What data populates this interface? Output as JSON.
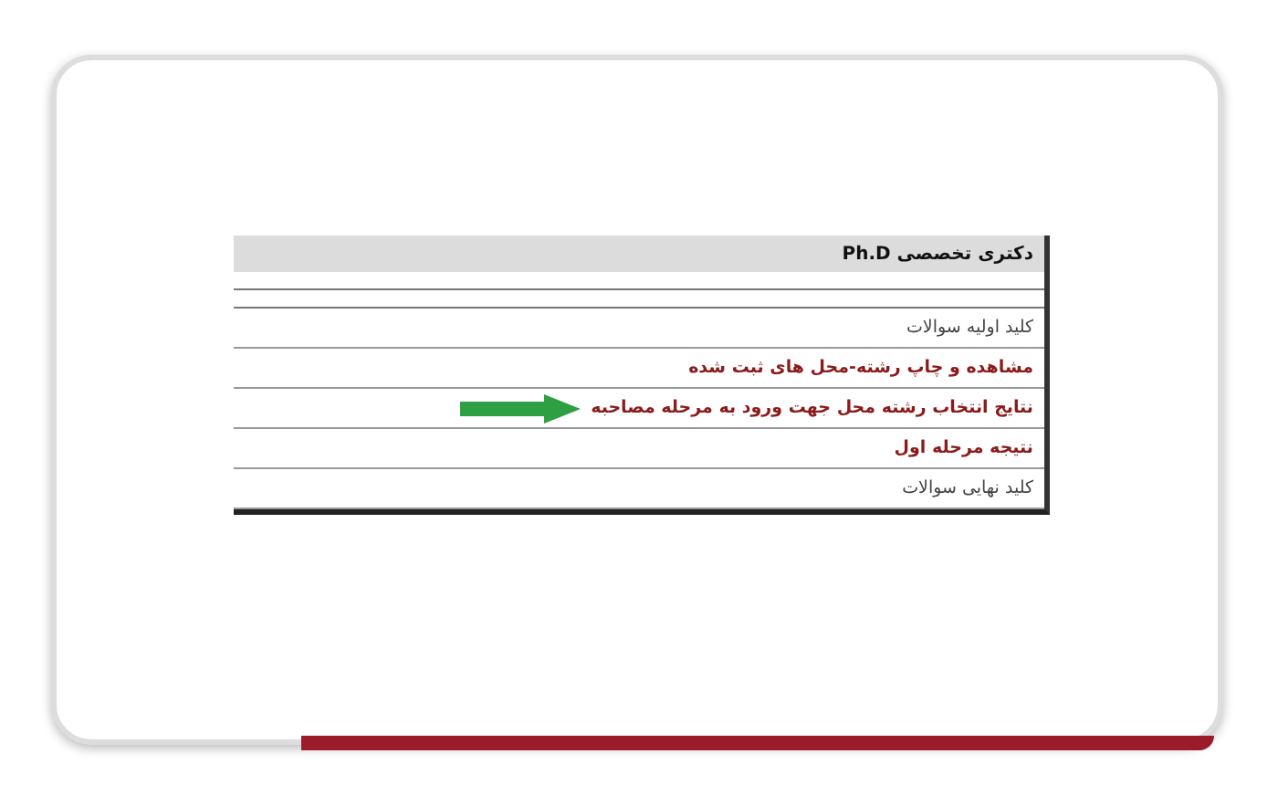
{
  "panel": {
    "title": "دکتری تخصصی Ph.D",
    "rows": [
      {
        "text": "کلید اولیه سوالات",
        "kind": "plain",
        "marked": false
      },
      {
        "text": "مشاهده و چاپ رشته-محل های ثبت شده",
        "kind": "highlight",
        "marked": false
      },
      {
        "text": "نتایج انتخاب رشته محل جهت ورود به مرحله مصاحبه",
        "kind": "highlight",
        "marked": true
      },
      {
        "text": "نتیجه مرحله اول",
        "kind": "highlight",
        "marked": false
      },
      {
        "text": "کلید نهایی سوالات",
        "kind": "plain",
        "marked": false
      }
    ]
  }
}
